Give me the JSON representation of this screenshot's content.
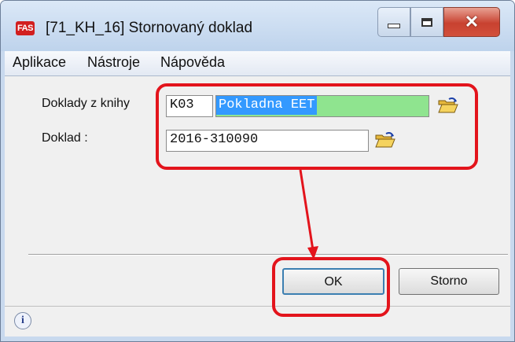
{
  "window": {
    "app_icon_text": "FAS",
    "title": "[71_KH_16] Stornovaný doklad"
  },
  "menu": [
    "Aplikace",
    "Nástroje",
    "Nápověda"
  ],
  "form": {
    "book_label": "Doklady z knihy",
    "book_code": "K03",
    "book_name": "Pokladna  EET",
    "doc_label": "Doklad :",
    "doc_value": "2016-310090"
  },
  "buttons": {
    "ok": "OK",
    "cancel": "Storno"
  },
  "status": {
    "info_icon_text": "i"
  },
  "colors": {
    "highlight": "#e3141c",
    "book_name_field_bg": "#8fe48f",
    "selection": "#3399ff"
  }
}
